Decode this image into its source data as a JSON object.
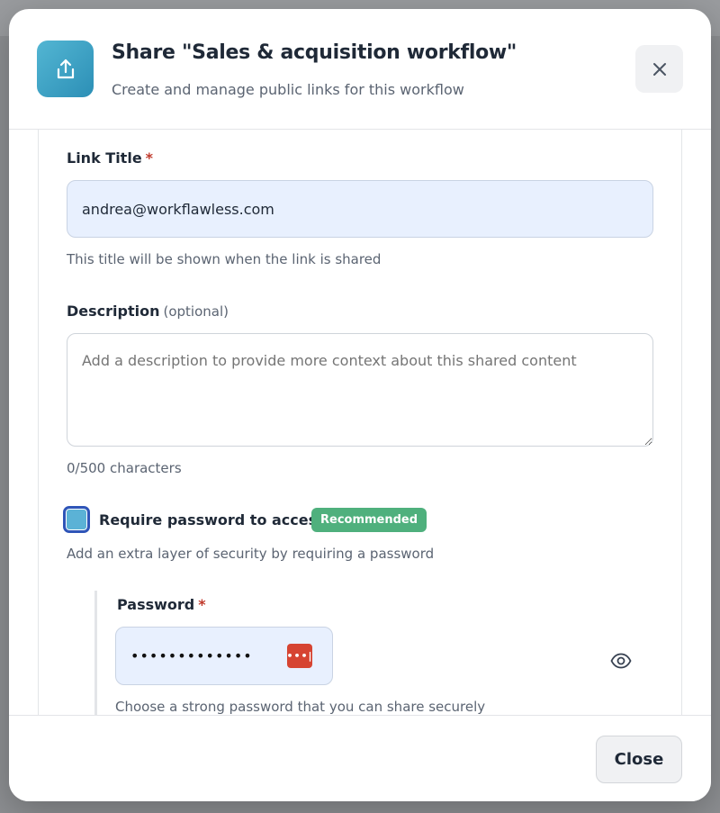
{
  "dialog": {
    "title": "Share \"Sales & acquisition workflow\"",
    "subtitle": "Create and manage public links for this workflow",
    "header_icon": "share-upload-icon",
    "accent_color": "#3a9dc2"
  },
  "form": {
    "link_title": {
      "label": "Link Title",
      "required_mark": "*",
      "value": "andrea@workflawless.com",
      "helper": "This title will be shown when the link is shared"
    },
    "description": {
      "label": "Description",
      "optional_label": "(optional)",
      "placeholder": "Add a description to provide more context about this shared content",
      "value": "",
      "counter": "0/500 characters"
    },
    "require_password": {
      "label": "Require password to access",
      "badge": "Recommended",
      "badge_color": "#4fb07d",
      "helper": "Add an extra layer of security by requiring a password",
      "checked": true
    },
    "password": {
      "label": "Password",
      "required_mark": "*",
      "value": "•••••••••••••",
      "helper": "Choose a strong password that you can share securely",
      "manager_icon_text": "•••|",
      "toggle_icon": "eye-icon"
    }
  },
  "footer": {
    "close_label": "Close"
  }
}
